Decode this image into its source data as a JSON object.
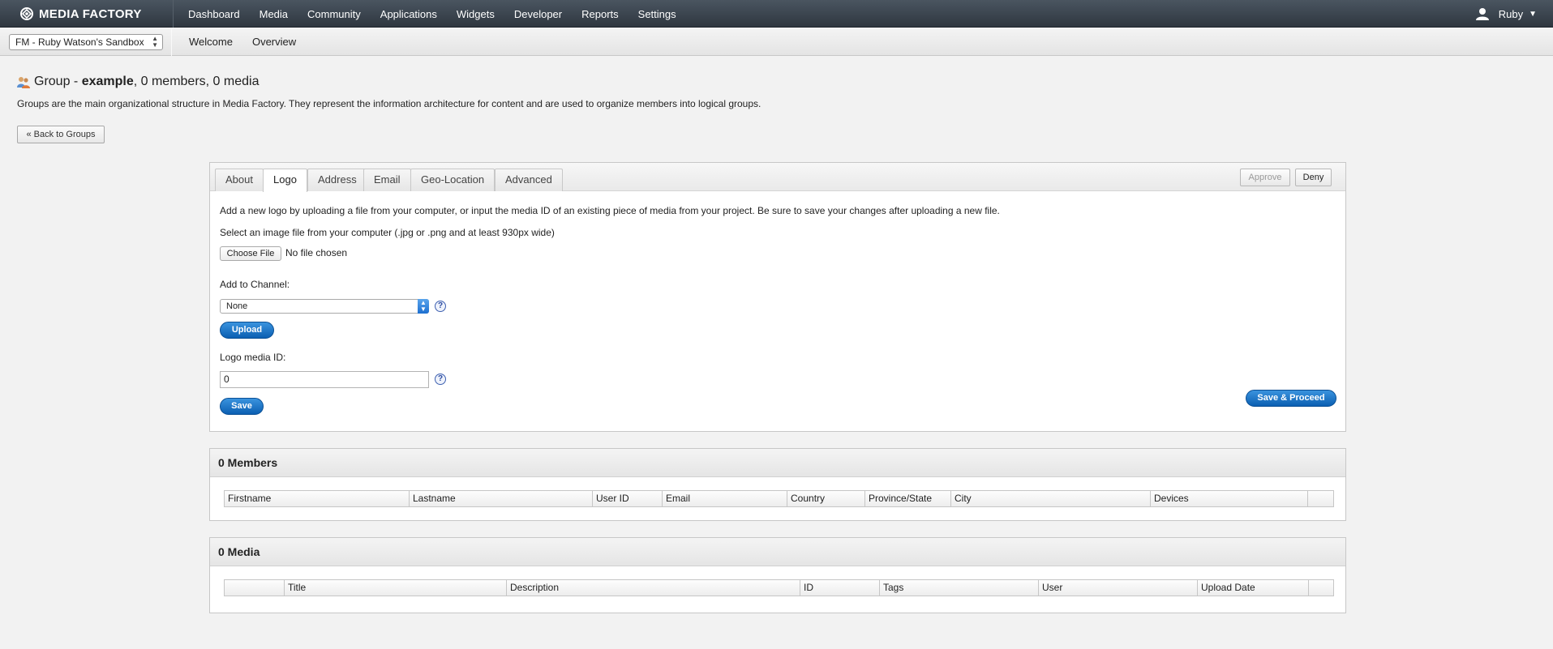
{
  "app": {
    "brand": "MEDIA FACTORY",
    "nav": [
      "Dashboard",
      "Media",
      "Community",
      "Applications",
      "Widgets",
      "Developer",
      "Reports",
      "Settings"
    ],
    "user_name": "Ruby",
    "colors": {
      "topbar": "#36404a",
      "accent": "#1d6fd0"
    }
  },
  "subbar": {
    "project_selected": "FM - Ruby Watson's Sandbox",
    "nav": [
      "Welcome",
      "Overview"
    ]
  },
  "page": {
    "title_prefix": "Group - ",
    "title_name": "example",
    "title_suffix": ", 0 members, 0 media",
    "description": "Groups are the main organizational structure in Media Factory. They represent the information architecture for content and are used to organize members into logical groups.",
    "back_label": "« Back to Groups"
  },
  "panel": {
    "tabs": [
      "About",
      "Logo",
      "Address",
      "Email",
      "Geo-Location",
      "Advanced"
    ],
    "active_tab": "Logo",
    "approve_label": "Approve",
    "deny_label": "Deny",
    "intro": "Add a new logo by uploading a file from your computer, or input the media ID of an existing piece of media from your project. Be sure to save your changes after uploading a new file.",
    "file_hint": "Select an image file from your computer (.jpg or .png and at least 930px wide)",
    "choose_file_label": "Choose File",
    "no_file_label": "No file chosen",
    "channel_label": "Add to Channel:",
    "channel_selected": "None",
    "upload_label": "Upload",
    "media_id_label": "Logo media ID:",
    "media_id_value": "0",
    "save_label": "Save",
    "save_proceed_label": "Save & Proceed",
    "help_glyph": "?"
  },
  "members": {
    "title": "0 Members",
    "columns": [
      "Firstname",
      "Lastname",
      "User ID",
      "Email",
      "Country",
      "Province/State",
      "City",
      "Devices",
      ""
    ]
  },
  "media": {
    "title": "0 Media",
    "columns": [
      "",
      "Title",
      "Description",
      "ID",
      "Tags",
      "User",
      "Upload Date",
      ""
    ]
  }
}
